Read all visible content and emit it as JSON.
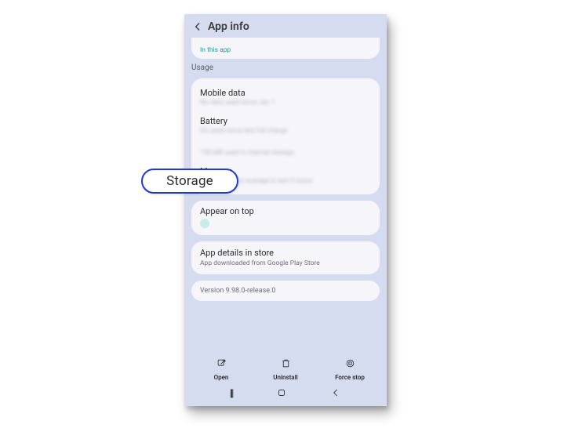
{
  "header": {
    "title": "App info"
  },
  "top_card": {
    "in_this_app": "In this app"
  },
  "usage_section": {
    "label": "Usage",
    "mobile_data": {
      "title": "Mobile data",
      "sub": "No data used since Jan 1"
    },
    "battery": {
      "title": "Battery",
      "sub": "0% used since last full charge"
    },
    "storage": {
      "title": "Storage",
      "sub": "150 MB used in internal storage"
    },
    "memory": {
      "title": "Memory",
      "sub": "12 MB used on average in last 3 hours"
    }
  },
  "appear_on_top": {
    "title": "Appear on top"
  },
  "store": {
    "title": "App details in store",
    "sub": "App downloaded from Google Play Store"
  },
  "version": {
    "text": "Version 9.98.0-release.0"
  },
  "actions": {
    "open": "Open",
    "uninstall": "Uninstall",
    "force_stop": "Force stop"
  },
  "callout": {
    "label": "Storage"
  }
}
